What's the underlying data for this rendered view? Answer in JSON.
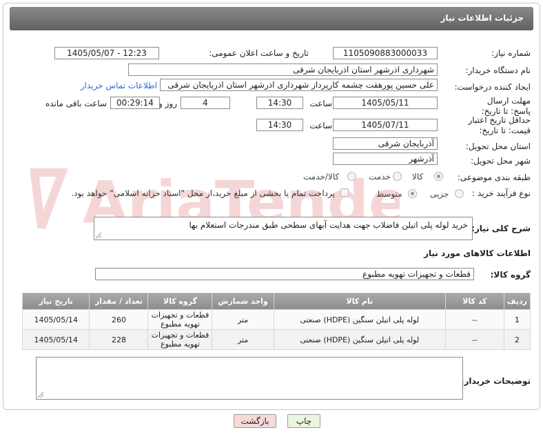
{
  "header": {
    "title": "جزئیات اطلاعات نیاز"
  },
  "fields": {
    "need_number_label": "شماره نیاز:",
    "need_number": "1105090883000033",
    "announce_label": "تاریخ و ساعت اعلان عمومی:",
    "announce_value": "1405/05/07 - 12:23",
    "buyer_org_label": "نام دستگاه خریدار:",
    "buyer_org": "شهرداری اذرشهر استان اذربایجان شرقی",
    "creator_label": "ایجاد کننده درخواست:",
    "creator": "علی حسین پورهفت چشمه کارپرداز شهرداری اذرشهر استان اذربایجان شرقی",
    "contact_link": "اطلاعات تماس خریدار",
    "deadline_label": "مهلت ارسال پاسخ: تا تاریخ:",
    "deadline_date": "1405/05/11",
    "time_label": "ساعت",
    "deadline_time": "14:30",
    "days_value": "4",
    "days_label": "روز و",
    "remaining_time": "00:29:14",
    "remaining_label": "ساعت باقی مانده",
    "price_validity_label": "حداقل تاریخ اعتبار قیمت: تا تاریخ:",
    "price_validity_date": "1405/07/11",
    "price_validity_time": "14:30",
    "province_label": "استان محل تحویل:",
    "province": "آذربایجان شرقی",
    "city_label": "شهر محل تحویل:",
    "city": "آذرشهر",
    "category_label": "طبقه بندی موضوعی:",
    "category_options": [
      "کالا",
      "خدمت",
      "کالا/خدمت"
    ],
    "process_label": "نوع فرآیند خرید :",
    "process_options": [
      "جزیی",
      "متوسط"
    ],
    "payment_note": "پرداخت تمام یا بخشی از مبلغ خرید،از محل \"اسناد خزانه اسلامی\" خواهد بود.",
    "description_label": "شرح کلی نیاز:",
    "description": "خرید لوله پلی اتیلن فاضلاب جهت هدایت آبهای سطحی طبق مندرجات استعلام بها",
    "goods_info_title": "اطلاعات کالاهای مورد نیاز",
    "goods_group_label": "گروه کالا:",
    "goods_group": "قطعات و تجهیزات تهویه مطبوع",
    "buyer_notes_label": "توضیحات خریدار:"
  },
  "table": {
    "headers": [
      "ردیف",
      "کد کالا",
      "نام کالا",
      "واحد شمارش",
      "گروه کالا",
      "تعداد / مقدار",
      "تاریخ نیاز"
    ],
    "rows": [
      [
        "1",
        "--",
        "لوله پلی اتیلن سنگین (HDPE) صنعتی",
        "متر",
        "قطعات و تجهیزات تهویه مطبوع",
        "260",
        "1405/05/14"
      ],
      [
        "2",
        "--",
        "لوله پلی اتیلن سنگین (HDPE) صنعتی",
        "متر",
        "قطعات و تجهیزات تهویه مطبوع",
        "228",
        "1405/05/14"
      ]
    ]
  },
  "buttons": {
    "print": "چاپ",
    "back": "بازگشت"
  },
  "watermark": {
    "text": "AriaTender.net"
  },
  "colors": {
    "header": "#707070",
    "link": "#2a6fd6",
    "back_button": "#f6dada",
    "print_button": "#eaf6df"
  }
}
